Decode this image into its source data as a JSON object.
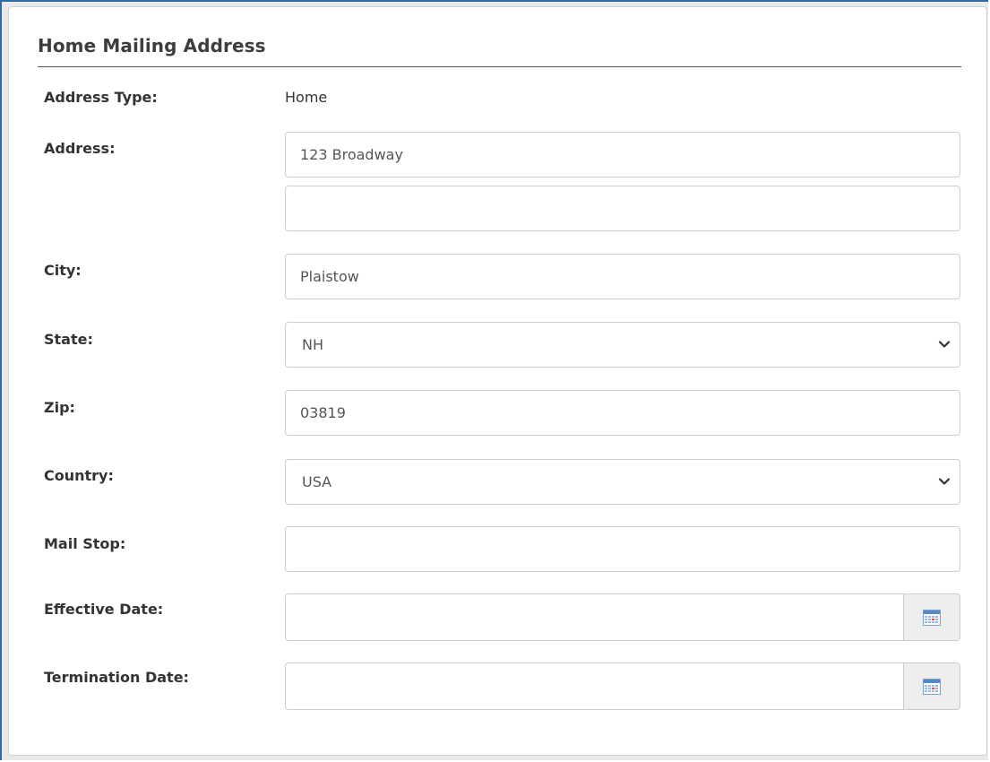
{
  "section": {
    "title": "Home Mailing Address"
  },
  "labels": {
    "address_type": "Address Type:",
    "address": "Address:",
    "city": "City:",
    "state": "State:",
    "zip": "Zip:",
    "country": "Country:",
    "mail_stop": "Mail Stop:",
    "effective_date": "Effective Date:",
    "termination_date": "Termination Date:"
  },
  "values": {
    "address_type": "Home",
    "address_line1": "123 Broadway",
    "address_line2": "",
    "city": "Plaistow",
    "state": "NH",
    "zip": "03819",
    "country": "USA",
    "mail_stop": "",
    "effective_date": "",
    "termination_date": ""
  },
  "icons": {
    "select_arrow": "chevron-down-icon",
    "date_picker": "calendar-icon"
  },
  "colors": {
    "window_border": "#2e6aa6",
    "input_border": "#cccccc",
    "date_button_bg": "#eeeeee"
  }
}
